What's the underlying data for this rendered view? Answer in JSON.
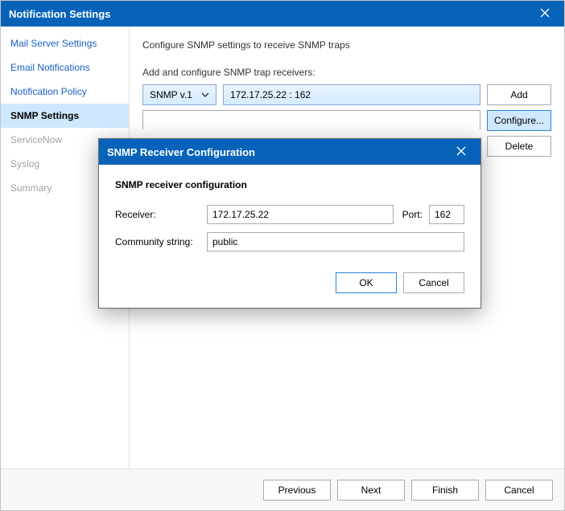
{
  "window": {
    "title": "Notification Settings"
  },
  "sidebar": {
    "items": [
      {
        "label": "Mail Server Settings"
      },
      {
        "label": "Email Notifications"
      },
      {
        "label": "Notification Policy"
      },
      {
        "label": "SNMP Settings"
      },
      {
        "label": "ServiceNow"
      },
      {
        "label": "Syslog"
      },
      {
        "label": "Summary"
      }
    ]
  },
  "main": {
    "description": "Configure SNMP settings to receive SNMP traps",
    "list_header": "Add and configure SNMP trap receivers:",
    "version_selected": "SNMP v.1",
    "selected_receiver": "172.17.25.22 : 162",
    "buttons": {
      "add": "Add",
      "configure": "Configure...",
      "delete": "Delete"
    }
  },
  "modal": {
    "title": "SNMP Receiver Configuration",
    "section_title": "SNMP receiver configuration",
    "labels": {
      "receiver": "Receiver:",
      "port": "Port:",
      "community": "Community string:"
    },
    "values": {
      "receiver": "172.17.25.22",
      "port": "162",
      "community": "public"
    },
    "buttons": {
      "ok": "OK",
      "cancel": "Cancel"
    }
  },
  "footer": {
    "previous": "Previous",
    "next": "Next",
    "finish": "Finish",
    "cancel": "Cancel"
  }
}
